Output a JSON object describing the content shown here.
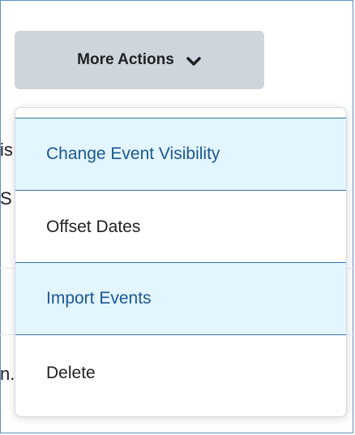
{
  "toolbar": {
    "more_actions_label": "More Actions"
  },
  "background": {
    "fragment_1": "is",
    "fragment_2": "S",
    "fragment_3": "n."
  },
  "menu": {
    "items": [
      {
        "label": "Change Event Visibility",
        "highlighted": true
      },
      {
        "label": "Offset Dates",
        "highlighted": false
      },
      {
        "label": "Import Events",
        "highlighted": true
      },
      {
        "label": "Delete",
        "highlighted": false
      }
    ]
  },
  "colors": {
    "button_bg": "#cdd5dd",
    "highlight_bg": "#e3f5fe",
    "highlight_text": "#1a5893",
    "highlight_border": "#3a74b0"
  },
  "icons": {
    "more_actions": "chevron-down-icon"
  }
}
